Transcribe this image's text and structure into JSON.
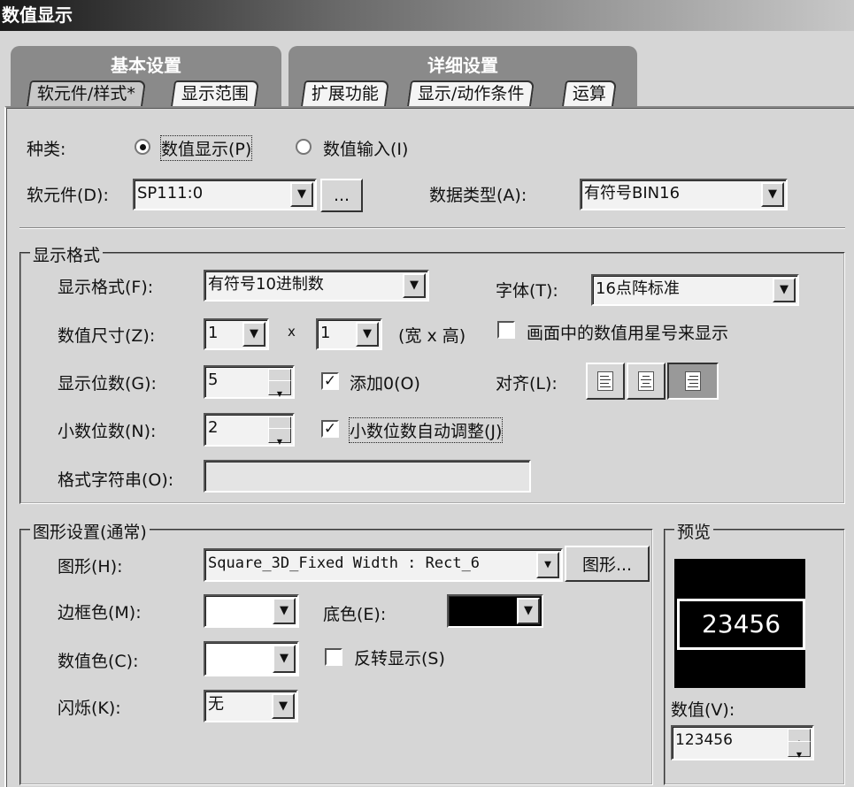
{
  "window": {
    "title": "数值显示"
  },
  "tab_groups": [
    {
      "label": "基本设置",
      "tabs": [
        "软元件/样式*",
        "显示范围"
      ]
    },
    {
      "label": "详细设置",
      "tabs": [
        "扩展功能",
        "显示/动作条件",
        "运算"
      ]
    }
  ],
  "type_row": {
    "label": "种类:",
    "options": [
      "数值显示(P)",
      "数值输入(I)"
    ],
    "selected": "数值显示(P)"
  },
  "device": {
    "label": "软元件(D):",
    "value": "SP111:0",
    "browse": "..."
  },
  "data_type": {
    "label": "数据类型(A):",
    "value": "有符号BIN16"
  },
  "display_format": {
    "legend": "显示格式",
    "format": {
      "label": "显示格式(F):",
      "value": "有符号10进制数"
    },
    "font": {
      "label": "字体(T):",
      "value": "16点阵标准"
    },
    "size": {
      "label": "数值尺寸(Z):",
      "width": "1",
      "x": "x",
      "height": "1",
      "hint": "(宽 x 高)"
    },
    "asterisk": {
      "label": "画面中的数值用星号来显示",
      "checked": false
    },
    "digits": {
      "label": "显示位数(G):",
      "value": "5"
    },
    "add_zero": {
      "label": "添加0(O)",
      "checked": true
    },
    "align": {
      "label": "对齐(L):",
      "selected": "right"
    },
    "decimals": {
      "label": "小数位数(N):",
      "value": "2"
    },
    "auto_decimal": {
      "label": "小数位数自动调整(J)",
      "checked": true
    },
    "format_string": {
      "label": "格式字符串(O):",
      "value": ""
    }
  },
  "shape_settings": {
    "legend": "图形设置(通常)",
    "shape": {
      "label": "图形(H):",
      "value": "Square_3D_Fixed Width : Rect_6",
      "button": "图形..."
    },
    "frame_color": {
      "label": "边框色(M):",
      "color": "#ffffff"
    },
    "base_color": {
      "label": "底色(E):",
      "color": "#000000"
    },
    "value_color": {
      "label": "数值色(C):",
      "color": "#ffffff"
    },
    "invert": {
      "label": "反转显示(S)",
      "checked": false
    },
    "blink": {
      "label": "闪烁(K):",
      "value": "无"
    }
  },
  "preview": {
    "legend": "预览",
    "display": "23456",
    "value_label": "数值(V):",
    "value": "123456"
  }
}
